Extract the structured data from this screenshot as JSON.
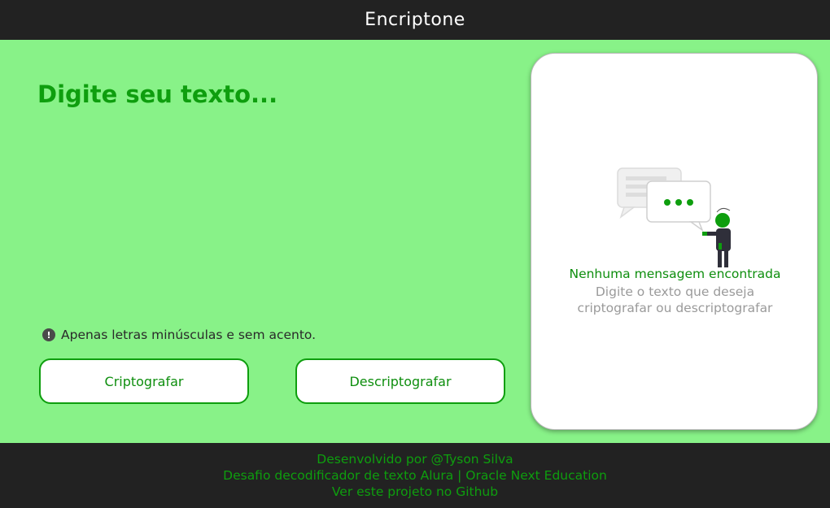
{
  "header": {
    "title": "Encriptone"
  },
  "input": {
    "placeholder": "Digite seu texto..."
  },
  "hint": {
    "icon": "exclamation-circle-icon",
    "text": "Apenas letras minúsculas e sem acento."
  },
  "buttons": {
    "encrypt": "Criptografar",
    "decrypt": "Descriptografar"
  },
  "output": {
    "illustration": "chat-bubbles-person-illustration",
    "title": "Nenhuma mensagem encontrada",
    "description": "Digite o texto que deseja criptografar ou descriptografar"
  },
  "footer": {
    "credit": "Desenvolvido por @Tyson Silva",
    "challenge": "Desafio decodificador de texto Alura | Oracle Next Education",
    "github_link": "Ver este projeto no Github"
  },
  "colors": {
    "background": "#88f288",
    "accent": "#0e9e0e",
    "bar": "#222222"
  }
}
